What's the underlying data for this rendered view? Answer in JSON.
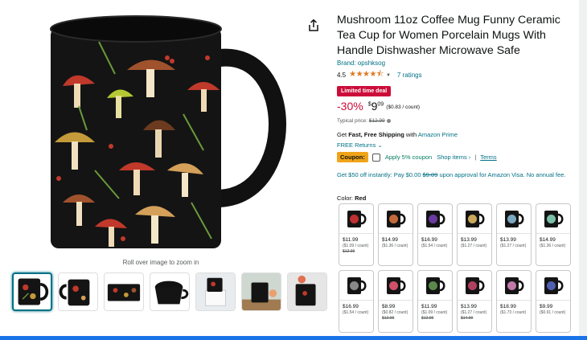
{
  "product": {
    "title": "Mushroom 11oz Coffee Mug Funny Ceramic Tea Cup for Women Porcelain Mugs With Handle Dishwasher Microwave Safe",
    "brand": "Brand: opshksog",
    "rating": "4.5",
    "stars": "★★★★⯪",
    "ratings_count": "7 ratings",
    "deal_badge": "Limited time deal",
    "discount": "-30%",
    "price_symbol": "$",
    "price_whole": "9",
    "price_fraction": "09",
    "unit_price": "($0.83 / count)",
    "typical_label": "Typical price:",
    "typical_price": "$12.99",
    "ship_prefix": "Get",
    "ship_fast": "Fast, Free Shipping",
    "ship_with": "with",
    "ship_prime": "Amazon Prime",
    "returns": "FREE Returns",
    "coupon_badge": "Coupon:",
    "coupon_text": "Apply 5% coupon",
    "coupon_shop": "Shop items ›",
    "coupon_sep": "|",
    "coupon_terms": "Terms",
    "visa_pre": "Get $50 off instantly: Pay $0.00",
    "visa_strike": "$9.09",
    "visa_post": "upon approval for Amazon Visa. No annual fee.",
    "color_label": "Color:",
    "color_value": "Red"
  },
  "gallery": {
    "zoom_hint": "Roll over image to zoom in"
  },
  "icons": {
    "share": "share-icon",
    "chevron": "chevron-down-icon"
  },
  "colors": {
    "accent_link": "#007185",
    "deal_red": "#cc0c39",
    "star": "#de7921",
    "coupon": "#f0a419",
    "mug_black": "#111111"
  },
  "swatches": [
    {
      "price": "$11.99",
      "unit": "($1.09 / count)",
      "list": "$12.99",
      "art": "#c03030"
    },
    {
      "price": "$14.99",
      "unit": "($1.36 / count)",
      "list": "",
      "art": "#c46a3a"
    },
    {
      "price": "$16.99",
      "unit": "($1.54 / count)",
      "list": "",
      "art": "#6a3aa0"
    },
    {
      "price": "$13.99",
      "unit": "($1.27 / count)",
      "list": "",
      "art": "#c9a85a"
    },
    {
      "price": "$13.99",
      "unit": "($1.27 / count)",
      "list": "",
      "art": "#7aa8c0"
    },
    {
      "price": "$14.99",
      "unit": "($1.36 / count)",
      "list": "",
      "art": "#7ac0a8"
    },
    {
      "price": "$16.99",
      "unit": "($1.54 / count)",
      "list": "",
      "art": "#888888"
    },
    {
      "price": "$8.99",
      "unit": "($0.82 / count)",
      "list": "$12.99",
      "art": "#d0506a"
    },
    {
      "price": "$11.99",
      "unit": "($1.09 / count)",
      "list": "$12.99",
      "art": "#5a8a4a"
    },
    {
      "price": "$13.99",
      "unit": "($1.27 / count)",
      "list": "$14.99",
      "art": "#b04060"
    },
    {
      "price": "$18.99",
      "unit": "($1.73 / count)",
      "list": "",
      "art": "#c07aa8"
    },
    {
      "price": "$9.99",
      "unit": "($0.91 / count)",
      "list": "",
      "art": "#5060b0"
    }
  ]
}
